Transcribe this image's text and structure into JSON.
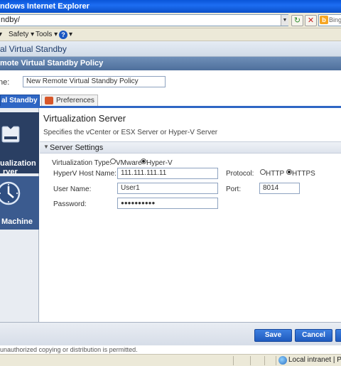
{
  "browser": {
    "title": "ndows Internet Explorer",
    "address": "ndby/",
    "search_placeholder": "Bing",
    "menu": {
      "safety": "Safety",
      "tools": "Tools"
    }
  },
  "app": {
    "header": "al Virtual Standby",
    "policy_bar": "mote Virtual Standby Policy",
    "name_label": "ne:",
    "name_value": "New Remote Virtual Standby Policy"
  },
  "tabs": [
    {
      "label": "al Standby",
      "active": true
    },
    {
      "label": "Preferences",
      "active": false
    }
  ],
  "nav": {
    "virtualization_server": {
      "line1": "ualization",
      "line2": "rver"
    },
    "virtual_machine": {
      "label": "Machine"
    }
  },
  "panel": {
    "title": "Virtualization Server",
    "description": "Specifies the vCenter or ESX Server or Hyper-V Server",
    "section": "Server Settings",
    "virtualization_type_label": "Virtualization Type:",
    "vmware_label": "VMware",
    "hyperv_label": "Hyper-V",
    "selected_type": "Hyper-V",
    "host_label": "HyperV Host Name:",
    "host_value": "111.111.111.11",
    "protocol_label": "Protocol:",
    "http_label": "HTTP",
    "https_label": "HTTPS",
    "selected_protocol": "HTTPS",
    "user_label": "User Name:",
    "user_value": "User1",
    "port_label": "Port:",
    "port_value": "8014",
    "password_label": "Password:",
    "password_value": "●●●●●●●●●●"
  },
  "footer": {
    "save": "Save",
    "cancel": "Cancel",
    "copyright": "unauthorized copying or distribution is permitted."
  },
  "status": {
    "zone": "Local intranet | Protec"
  }
}
